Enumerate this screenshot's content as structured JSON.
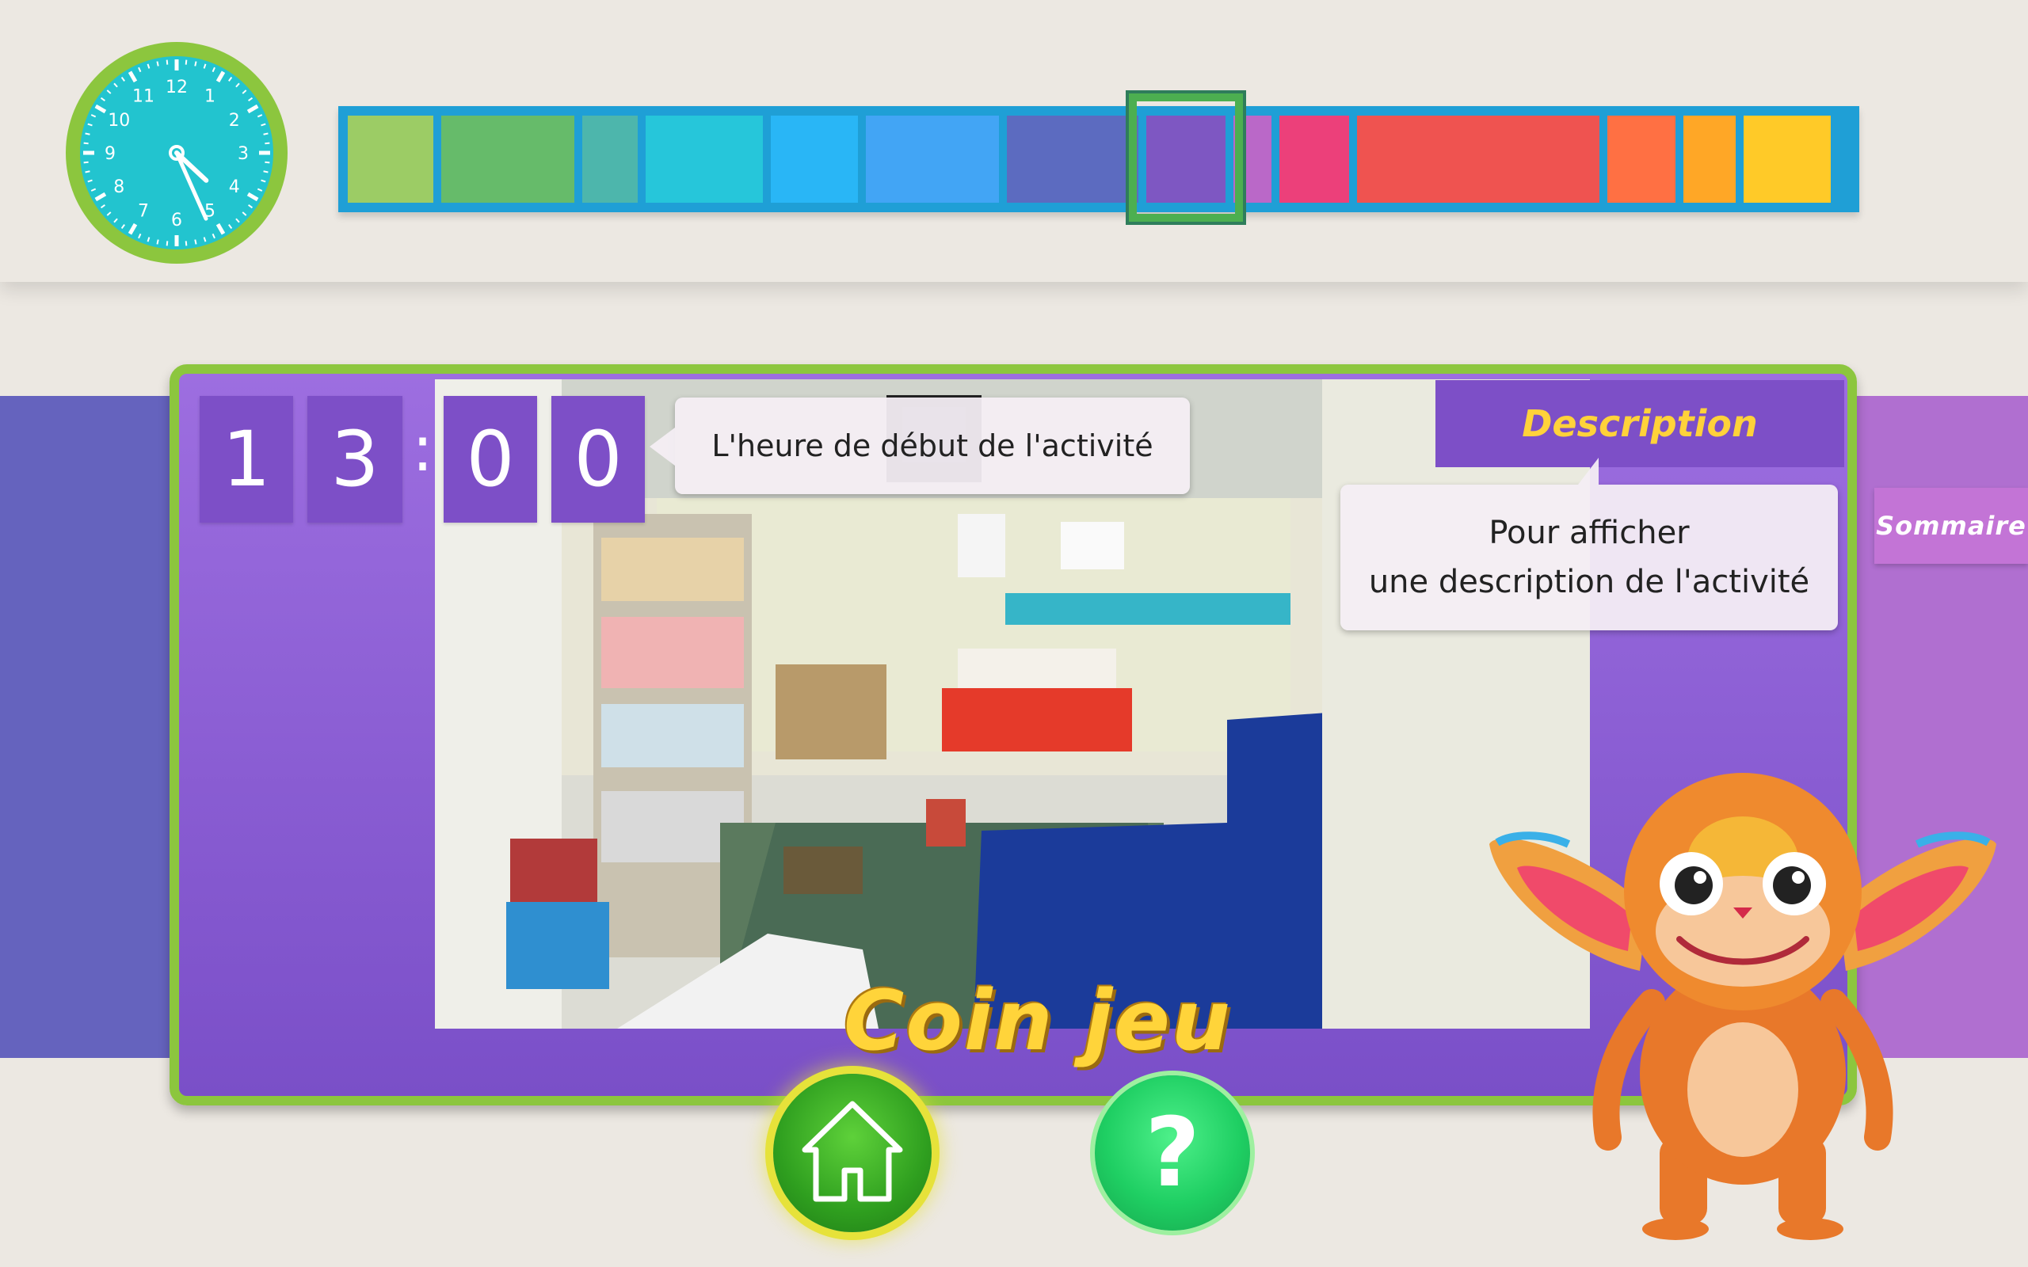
{
  "clock": {
    "hour": 4,
    "minute": 26
  },
  "timeline": {
    "segments": [
      {
        "color": "#9ccc65"
      },
      {
        "color": "#66bb6a"
      },
      {
        "color": "#4db6ac"
      },
      {
        "color": "#26c6da"
      },
      {
        "color": "#29b6f6"
      },
      {
        "color": "#42a5f5"
      },
      {
        "color": "#5c6bc0"
      },
      {
        "color": "#7e57c2",
        "current": true
      },
      {
        "color": "#ba68c8"
      },
      {
        "color": "#ec407a"
      },
      {
        "color": "#ef5350"
      },
      {
        "color": "#ff7043"
      },
      {
        "color": "#ffa726"
      },
      {
        "color": "#ffca28"
      }
    ]
  },
  "start_time": {
    "digits": [
      "1",
      "3",
      "0",
      "0"
    ],
    "separator": ":"
  },
  "tooltips": {
    "start_time": "L'heure de début de l'activité",
    "description_line1": "Pour afficher",
    "description_line2": "une description de l'activité"
  },
  "description_tab": "Description",
  "sommaire_tab": "Sommaire",
  "activity": {
    "title": "Coin jeu"
  },
  "buttons": {
    "help_glyph": "?"
  },
  "colors": {
    "card_border": "#8cc63e",
    "card_fill": "#8a5ed4",
    "title_yellow": "#ffd43a"
  }
}
